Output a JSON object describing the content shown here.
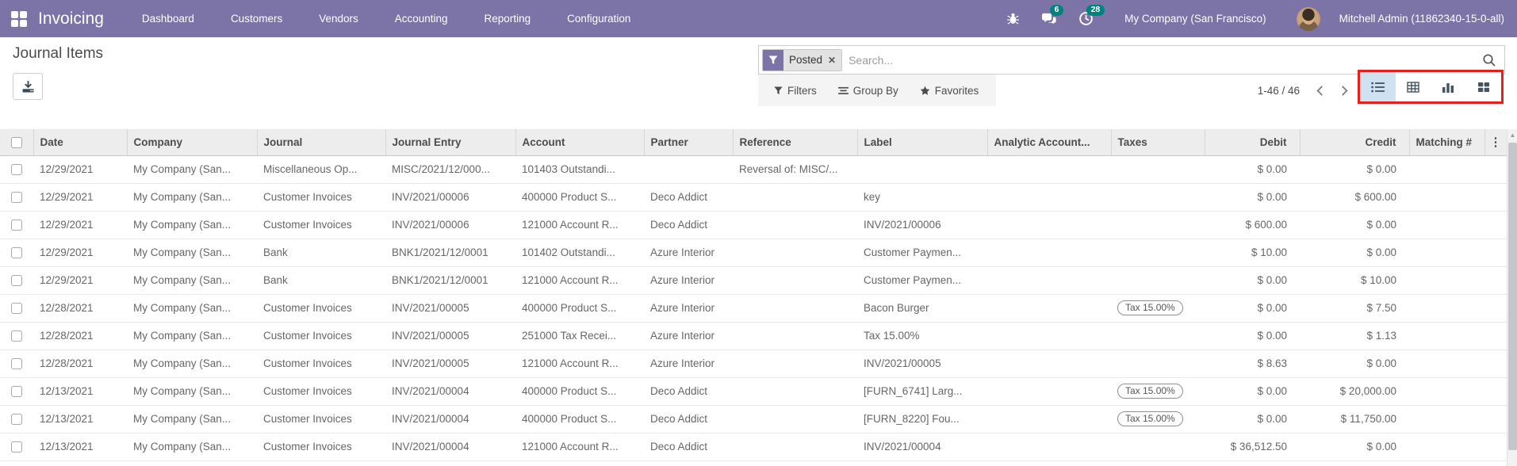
{
  "nav": {
    "brand": "Invoicing",
    "menu_items": [
      "Dashboard",
      "Customers",
      "Vendors",
      "Accounting",
      "Reporting",
      "Configuration"
    ],
    "messages_badge": "6",
    "activities_badge": "28",
    "company": "My Company (San Francisco)",
    "user": "Mitchell Admin (11862340-15-0-all)"
  },
  "control_panel": {
    "title": "Journal Items",
    "search": {
      "facet_label": "Posted",
      "placeholder": "Search..."
    },
    "filters_label": "Filters",
    "group_by_label": "Group By",
    "favorites_label": "Favorites",
    "pager": {
      "text": "1-46 / 46"
    }
  },
  "icons": {
    "facet_remove": "✕",
    "more_columns": "⋮",
    "scroll_up": "▲"
  },
  "colors": {
    "navbar_purple": "#7c73a6",
    "badge_teal": "#00837f",
    "highlight_red": "#e2211c",
    "active_view_blue": "#cfe2f2"
  },
  "table": {
    "headers": [
      "Date",
      "Company",
      "Journal",
      "Journal Entry",
      "Account",
      "Partner",
      "Reference",
      "Label",
      "Analytic Account...",
      "Taxes",
      "Debit",
      "Credit",
      "Matching #"
    ],
    "rows": [
      {
        "date": "12/29/2021",
        "company": "My Company (San...",
        "journal": "Miscellaneous Op...",
        "entry": "MISC/2021/12/000...",
        "account": "101403 Outstandi...",
        "partner": "",
        "reference": "Reversal of: MISC/...",
        "label": "",
        "analytic": "",
        "taxes": "",
        "debit": "$ 0.00",
        "credit": "$ 0.00",
        "matching": ""
      },
      {
        "date": "12/29/2021",
        "company": "My Company (San...",
        "journal": "Customer Invoices",
        "entry": "INV/2021/00006",
        "account": "400000 Product S...",
        "partner": "Deco Addict",
        "reference": "",
        "label": "key",
        "analytic": "",
        "taxes": "",
        "debit": "$ 0.00",
        "credit": "$ 600.00",
        "matching": ""
      },
      {
        "date": "12/29/2021",
        "company": "My Company (San...",
        "journal": "Customer Invoices",
        "entry": "INV/2021/00006",
        "account": "121000 Account R...",
        "partner": "Deco Addict",
        "reference": "",
        "label": "INV/2021/00006",
        "analytic": "",
        "taxes": "",
        "debit": "$ 600.00",
        "credit": "$ 0.00",
        "matching": ""
      },
      {
        "date": "12/29/2021",
        "company": "My Company (San...",
        "journal": "Bank",
        "entry": "BNK1/2021/12/0001",
        "account": "101402 Outstandi...",
        "partner": "Azure Interior",
        "reference": "",
        "label": "Customer Paymen...",
        "analytic": "",
        "taxes": "",
        "debit": "$ 10.00",
        "credit": "$ 0.00",
        "matching": ""
      },
      {
        "date": "12/29/2021",
        "company": "My Company (San...",
        "journal": "Bank",
        "entry": "BNK1/2021/12/0001",
        "account": "121000 Account R...",
        "partner": "Azure Interior",
        "reference": "",
        "label": "Customer Paymen...",
        "analytic": "",
        "taxes": "",
        "debit": "$ 0.00",
        "credit": "$ 10.00",
        "matching": ""
      },
      {
        "date": "12/28/2021",
        "company": "My Company (San...",
        "journal": "Customer Invoices",
        "entry": "INV/2021/00005",
        "account": "400000 Product S...",
        "partner": "Azure Interior",
        "reference": "",
        "label": "Bacon Burger",
        "analytic": "",
        "taxes": "Tax 15.00%",
        "debit": "$ 0.00",
        "credit": "$ 7.50",
        "matching": ""
      },
      {
        "date": "12/28/2021",
        "company": "My Company (San...",
        "journal": "Customer Invoices",
        "entry": "INV/2021/00005",
        "account": "251000 Tax Recei...",
        "partner": "Azure Interior",
        "reference": "",
        "label": "Tax 15.00%",
        "analytic": "",
        "taxes": "",
        "debit": "$ 0.00",
        "credit": "$ 1.13",
        "matching": ""
      },
      {
        "date": "12/28/2021",
        "company": "My Company (San...",
        "journal": "Customer Invoices",
        "entry": "INV/2021/00005",
        "account": "121000 Account R...",
        "partner": "Azure Interior",
        "reference": "",
        "label": "INV/2021/00005",
        "analytic": "",
        "taxes": "",
        "debit": "$ 8.63",
        "credit": "$ 0.00",
        "matching": ""
      },
      {
        "date": "12/13/2021",
        "company": "My Company (San...",
        "journal": "Customer Invoices",
        "entry": "INV/2021/00004",
        "account": "400000 Product S...",
        "partner": "Deco Addict",
        "reference": "",
        "label": "[FURN_6741] Larg...",
        "analytic": "",
        "taxes": "Tax 15.00%",
        "debit": "$ 0.00",
        "credit": "$ 20,000.00",
        "matching": ""
      },
      {
        "date": "12/13/2021",
        "company": "My Company (San...",
        "journal": "Customer Invoices",
        "entry": "INV/2021/00004",
        "account": "400000 Product S...",
        "partner": "Deco Addict",
        "reference": "",
        "label": "[FURN_8220] Fou...",
        "analytic": "",
        "taxes": "Tax 15.00%",
        "debit": "$ 0.00",
        "credit": "$ 11,750.00",
        "matching": ""
      },
      {
        "date": "12/13/2021",
        "company": "My Company (San...",
        "journal": "Customer Invoices",
        "entry": "INV/2021/00004",
        "account": "121000 Account R...",
        "partner": "Deco Addict",
        "reference": "",
        "label": "INV/2021/00004",
        "analytic": "",
        "taxes": "",
        "debit": "$ 36,512.50",
        "credit": "$ 0.00",
        "matching": ""
      }
    ]
  }
}
